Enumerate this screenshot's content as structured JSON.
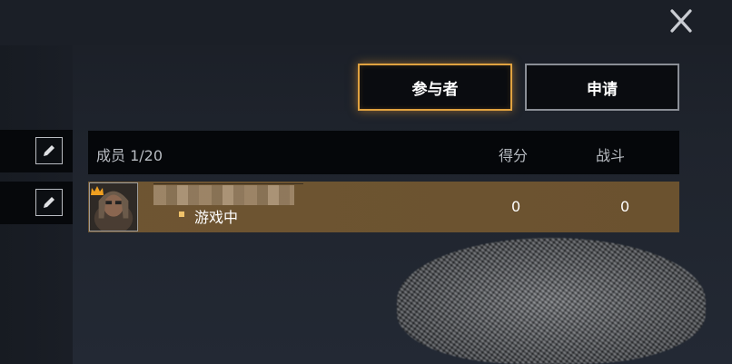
{
  "window": {
    "close_icon": "close-icon"
  },
  "tabs": [
    {
      "label": "参与者",
      "active": true
    },
    {
      "label": "申请",
      "active": false
    }
  ],
  "table": {
    "header": {
      "member": "成员 1/20",
      "score": "得分",
      "battle": "战斗"
    },
    "rows": [
      {
        "status": "游戏中",
        "score": "0",
        "battle": "0",
        "is_leader": true
      }
    ]
  },
  "colors": {
    "accent": "#e0a240",
    "row_bg": "#6e5532"
  }
}
